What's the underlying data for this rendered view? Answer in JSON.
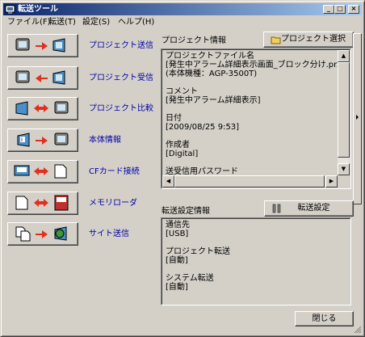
{
  "window": {
    "title": "転送ツール"
  },
  "menu": [
    "ファイル(F)",
    "転送(T)",
    "設定(S)",
    "ヘルプ(H)"
  ],
  "left_actions": [
    {
      "label": "プロジェクト送信"
    },
    {
      "label": "プロジェクト受信"
    },
    {
      "label": "プロジェクト比較"
    },
    {
      "label": "本体情報"
    },
    {
      "label": "CFカード接続"
    },
    {
      "label": "メモリローダ"
    },
    {
      "label": "サイト送信"
    }
  ],
  "project_info": {
    "label": "プロジェクト情報",
    "select_button": "プロジェクト選択",
    "lines": [
      "プロジェクトファイル名",
      "[発生中アラーム詳細表示画面_ブロック分け.prx]",
      "(本体機種：AGP-3500T)",
      "",
      "コメント",
      "[発生中アラーム詳細表示]",
      "",
      "日付",
      "[2009/08/25 9:53]",
      "",
      "作成者",
      "[Digital]",
      "",
      "送受信用パスワード"
    ]
  },
  "transfer_settings": {
    "label": "転送設定情報",
    "button": "転送設定",
    "lines": [
      "通信先",
      "[USB]",
      "",
      "プロジェクト転送",
      "[自動]",
      "",
      "システム転送",
      "[自動]"
    ]
  },
  "close_button": "閉じる",
  "colors": {
    "title_start": "#0a246a",
    "title_end": "#a6caf0",
    "face": "#d4d0c8",
    "link_text": "#0000aa",
    "arrow_red": "#e03020"
  },
  "title_buttons": {
    "minimize": "_",
    "maximize": "□",
    "close": "×"
  }
}
